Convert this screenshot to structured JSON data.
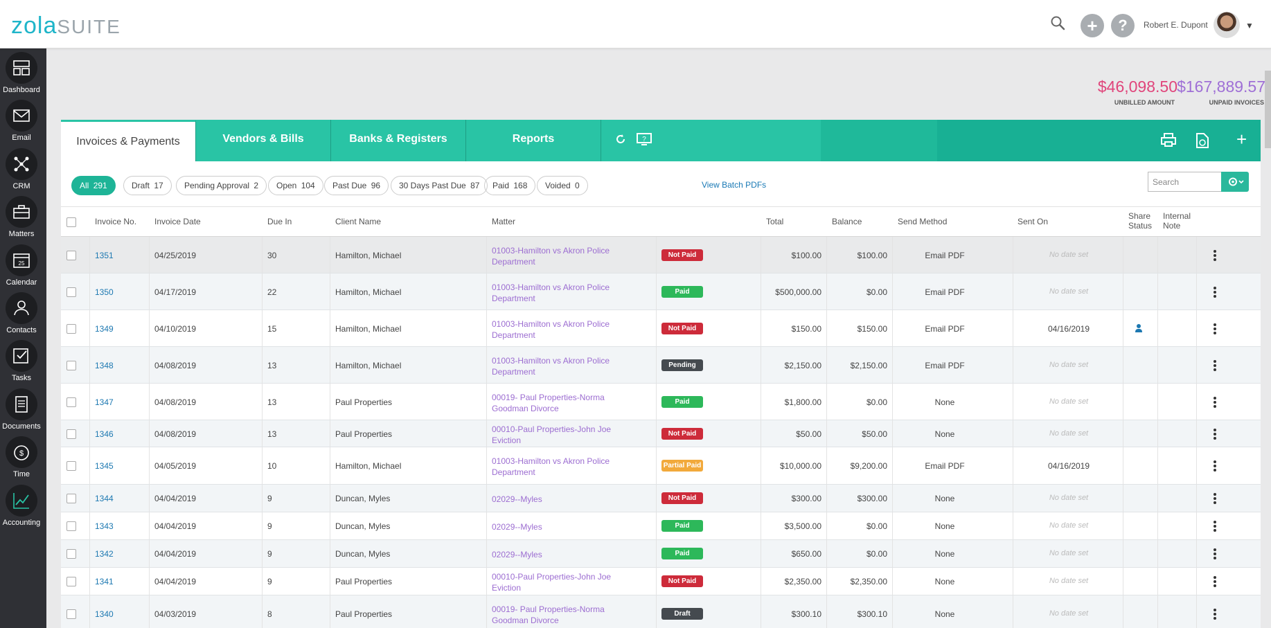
{
  "header": {
    "logo_main": "zola",
    "logo_suffix": "SUITE",
    "user_name": "Robert E. Dupont"
  },
  "sidebar": {
    "items": [
      {
        "label": "Dashboard",
        "icon": "dashboard-icon"
      },
      {
        "label": "Email",
        "icon": "email-icon"
      },
      {
        "label": "CRM",
        "icon": "crm-icon"
      },
      {
        "label": "Matters",
        "icon": "briefcase-icon"
      },
      {
        "label": "Calendar",
        "icon": "calendar-icon"
      },
      {
        "label": "Contacts",
        "icon": "contacts-icon"
      },
      {
        "label": "Tasks",
        "icon": "tasks-icon"
      },
      {
        "label": "Documents",
        "icon": "documents-icon"
      },
      {
        "label": "Time",
        "icon": "time-icon"
      },
      {
        "label": "Accounting",
        "icon": "accounting-icon"
      }
    ]
  },
  "totals": {
    "unbilled_amount": "$46,098.50",
    "unbilled_label": "UNBILLED AMOUNT",
    "unpaid_amount": "$167,889.57",
    "unpaid_label": "UNPAID INVOICES"
  },
  "tabs": {
    "invoices": "Invoices & Payments",
    "vendors": "Vendors & Bills",
    "banks": "Banks & Registers",
    "reports": "Reports"
  },
  "filters": [
    {
      "label": "All",
      "count": "291"
    },
    {
      "label": "Draft",
      "count": "17"
    },
    {
      "label": "Pending Approval",
      "count": "2"
    },
    {
      "label": "Open",
      "count": "104"
    },
    {
      "label": "Past Due",
      "count": "96"
    },
    {
      "label": "30 Days Past Due",
      "count": "87"
    },
    {
      "label": "Paid",
      "count": "168"
    },
    {
      "label": "Voided",
      "count": "0"
    }
  ],
  "batch_pdfs_label": "View Batch PDFs",
  "search": {
    "placeholder": "Search"
  },
  "columns": {
    "invoice_no": "Invoice No.",
    "invoice_date": "Invoice Date",
    "due_in": "Due In",
    "client_name": "Client Name",
    "matter": "Matter",
    "total": "Total",
    "balance": "Balance",
    "send_method": "Send Method",
    "sent_on": "Sent On",
    "share_status": "Share Status",
    "internal_note": "Internal Note"
  },
  "rows": [
    {
      "no": "1351",
      "date": "04/25/2019",
      "due": "30",
      "client": "Hamilton, Michael",
      "matter": "01003-Hamilton vs Akron Police Department",
      "status": "Not Paid",
      "total": "$100.00",
      "balance": "$100.00",
      "send": "Email PDF",
      "sent_on": "No date set"
    },
    {
      "no": "1350",
      "date": "04/17/2019",
      "due": "22",
      "client": "Hamilton, Michael",
      "matter": "01003-Hamilton vs Akron Police Department",
      "status": "Paid",
      "total": "$500,000.00",
      "balance": "$0.00",
      "send": "Email PDF",
      "sent_on": "No date set"
    },
    {
      "no": "1349",
      "date": "04/10/2019",
      "due": "15",
      "client": "Hamilton, Michael",
      "matter": "01003-Hamilton vs Akron Police Department",
      "status": "Not Paid",
      "total": "$150.00",
      "balance": "$150.00",
      "send": "Email PDF",
      "sent_on": "04/16/2019"
    },
    {
      "no": "1348",
      "date": "04/08/2019",
      "due": "13",
      "client": "Hamilton, Michael",
      "matter": "01003-Hamilton vs Akron Police Department",
      "status": "Pending",
      "total": "$2,150.00",
      "balance": "$2,150.00",
      "send": "Email PDF",
      "sent_on": "No date set"
    },
    {
      "no": "1347",
      "date": "04/08/2019",
      "due": "13",
      "client": "Paul Properties",
      "matter": "00019- Paul Properties-Norma Goodman Divorce",
      "status": "Paid",
      "total": "$1,800.00",
      "balance": "$0.00",
      "send": "None",
      "sent_on": "No date set"
    },
    {
      "no": "1346",
      "date": "04/08/2019",
      "due": "13",
      "client": "Paul Properties",
      "matter": "00010-Paul Properties-John Joe Eviction",
      "status": "Not Paid",
      "total": "$50.00",
      "balance": "$50.00",
      "send": "None",
      "sent_on": "No date set"
    },
    {
      "no": "1345",
      "date": "04/05/2019",
      "due": "10",
      "client": "Hamilton, Michael",
      "matter": "01003-Hamilton vs Akron Police Department",
      "status": "Partial Paid",
      "total": "$10,000.00",
      "balance": "$9,200.00",
      "send": "Email PDF",
      "sent_on": "04/16/2019"
    },
    {
      "no": "1344",
      "date": "04/04/2019",
      "due": "9",
      "client": "Duncan, Myles",
      "matter": "02029--Myles",
      "status": "Not Paid",
      "total": "$300.00",
      "balance": "$300.00",
      "send": "None",
      "sent_on": "No date set"
    },
    {
      "no": "1343",
      "date": "04/04/2019",
      "due": "9",
      "client": "Duncan, Myles",
      "matter": "02029--Myles",
      "status": "Paid",
      "total": "$3,500.00",
      "balance": "$0.00",
      "send": "None",
      "sent_on": "No date set"
    },
    {
      "no": "1342",
      "date": "04/04/2019",
      "due": "9",
      "client": "Duncan, Myles",
      "matter": "02029--Myles",
      "status": "Paid",
      "total": "$650.00",
      "balance": "$0.00",
      "send": "None",
      "sent_on": "No date set"
    },
    {
      "no": "1341",
      "date": "04/04/2019",
      "due": "9",
      "client": "Paul Properties",
      "matter": "00010-Paul Properties-John Joe Eviction",
      "status": "Not Paid",
      "total": "$2,350.00",
      "balance": "$2,350.00",
      "send": "None",
      "sent_on": "No date set"
    },
    {
      "no": "1340",
      "date": "04/03/2019",
      "due": "8",
      "client": "Paul Properties",
      "matter": "00019- Paul Properties-Norma Goodman Divorce",
      "status": "Draft",
      "total": "$300.10",
      "balance": "$300.10",
      "send": "None",
      "sent_on": "No date set"
    }
  ],
  "colors": {
    "accent": "#29c4a5",
    "link": "#1c78b1",
    "matter": "#9c6dd1",
    "not_paid": "#cd2b3a",
    "paid": "#2db85a",
    "pending": "#454a4f",
    "partial": "#f2a93b",
    "unbilled": "#e0457b",
    "unpaid": "#9f6fd6"
  }
}
